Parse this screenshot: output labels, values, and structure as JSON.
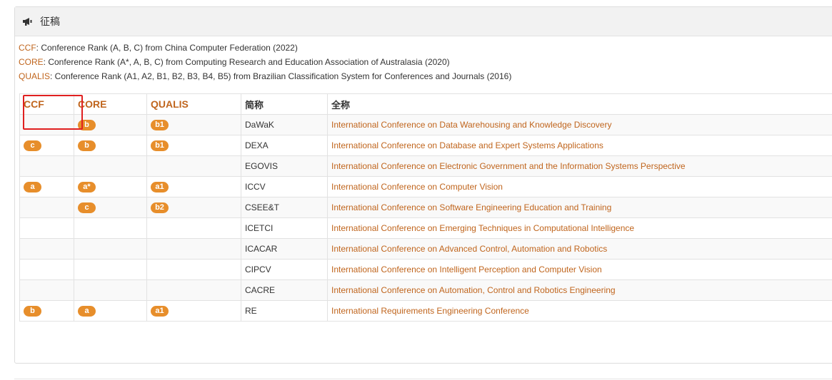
{
  "panel": {
    "title": "征稿",
    "icon": "megaphone-icon"
  },
  "legend": [
    {
      "key": "CCF",
      "text": ": Conference Rank (A, B, C) from China Computer Federation (2022)"
    },
    {
      "key": "CORE",
      "text": ": Conference Rank (A*, A, B, C) from Computing Research and Education Association of Australasia (2020)"
    },
    {
      "key": "QUALIS",
      "text": ": Conference Rank (A1, A2, B1, B2, B3, B4, B5) from Brazilian Classification System for Conferences and Journals (2016)"
    }
  ],
  "table": {
    "headers": {
      "ccf": "CCF",
      "core": "CORE",
      "qualis": "QUALIS",
      "short": "简称",
      "full": "全称"
    },
    "rows": [
      {
        "ccf": "",
        "core": "b",
        "qualis": "b1",
        "short": "DaWaK",
        "full": "International Conference on Data Warehousing and Knowledge Discovery"
      },
      {
        "ccf": "c",
        "core": "b",
        "qualis": "b1",
        "short": "DEXA",
        "full": "International Conference on Database and Expert Systems Applications"
      },
      {
        "ccf": "",
        "core": "",
        "qualis": "",
        "short": "EGOVIS",
        "full": "International Conference on Electronic Government and the Information Systems Perspective"
      },
      {
        "ccf": "a",
        "core": "a*",
        "qualis": "a1",
        "short": "ICCV",
        "full": "International Conference on Computer Vision"
      },
      {
        "ccf": "",
        "core": "c",
        "qualis": "b2",
        "short": "CSEE&T",
        "full": "International Conference on Software Engineering Education and Training"
      },
      {
        "ccf": "",
        "core": "",
        "qualis": "",
        "short": "ICETCI",
        "full": "International Conference on Emerging Techniques in Computational Intelligence"
      },
      {
        "ccf": "",
        "core": "",
        "qualis": "",
        "short": "ICACAR",
        "full": "International Conference on Advanced Control, Automation and Robotics"
      },
      {
        "ccf": "",
        "core": "",
        "qualis": "",
        "short": "CIPCV",
        "full": "International Conference on Intelligent Perception and Computer Vision"
      },
      {
        "ccf": "",
        "core": "",
        "qualis": "",
        "short": "CACRE",
        "full": "International Conference on Automation, Control and Robotics Engineering"
      },
      {
        "ccf": "b",
        "core": "a",
        "qualis": "a1",
        "short": "RE",
        "full": "International Requirements Engineering Conference"
      }
    ]
  },
  "colors": {
    "accent": "#c0651d",
    "badge": "#e78e2b",
    "highlight": "#e02020"
  }
}
